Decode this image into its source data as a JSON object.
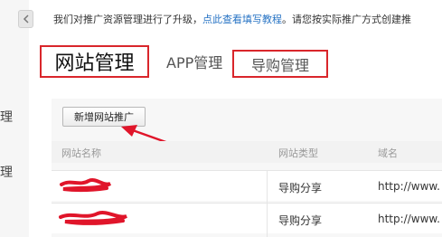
{
  "notice": {
    "text_before": "我们对推广资源管理进行了升级，",
    "link": "点此查看填写教程",
    "text_after": "。请您按实际推广方式创建推"
  },
  "sidebar": {
    "items": [
      "理",
      "理"
    ]
  },
  "tabs": [
    {
      "label": "网站管理",
      "active": true
    },
    {
      "label": "APP管理",
      "active": false
    },
    {
      "label": "导购管理",
      "active": false
    }
  ],
  "toolbar": {
    "add_label": "新增网站推广"
  },
  "table": {
    "headers": [
      "网站名称",
      "网站类型",
      "域名"
    ],
    "rows": [
      {
        "name": "",
        "type": "导购分享",
        "domain": "http://www."
      },
      {
        "name": "",
        "type": "导购分享",
        "domain": "http://www."
      }
    ]
  },
  "colors": {
    "highlight": "#d9262b",
    "link": "#2673c4",
    "redaction": "#e0152a"
  }
}
